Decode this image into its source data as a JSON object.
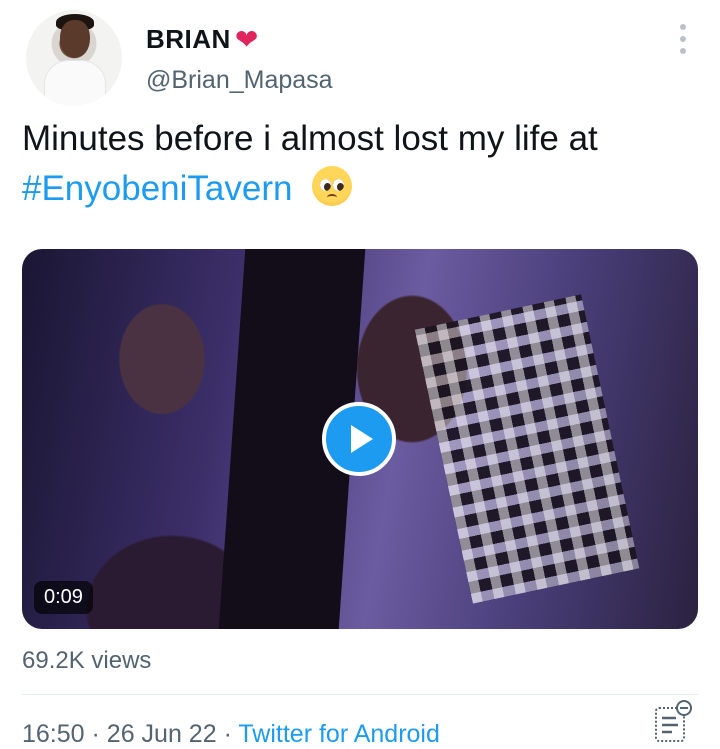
{
  "author": {
    "display_name": "BRIAN",
    "name_emoji": "❤",
    "handle": "@Brian_Mapasa"
  },
  "tweet": {
    "text": "Minutes before i almost lost my life at",
    "hashtag": "#EnyobeniTavern",
    "trailing_emoji": "pleading-face-emoji"
  },
  "media": {
    "type": "video",
    "duration": "0:09"
  },
  "stats": {
    "views": "69.2K views"
  },
  "meta": {
    "time": "16:50",
    "date": "26 Jun 22",
    "separator": "·",
    "source": "Twitter for Android"
  },
  "colors": {
    "accent": "#1d9bf0",
    "text": "#0f1419",
    "secondary_text": "#536471",
    "heart": "#e0245e"
  }
}
